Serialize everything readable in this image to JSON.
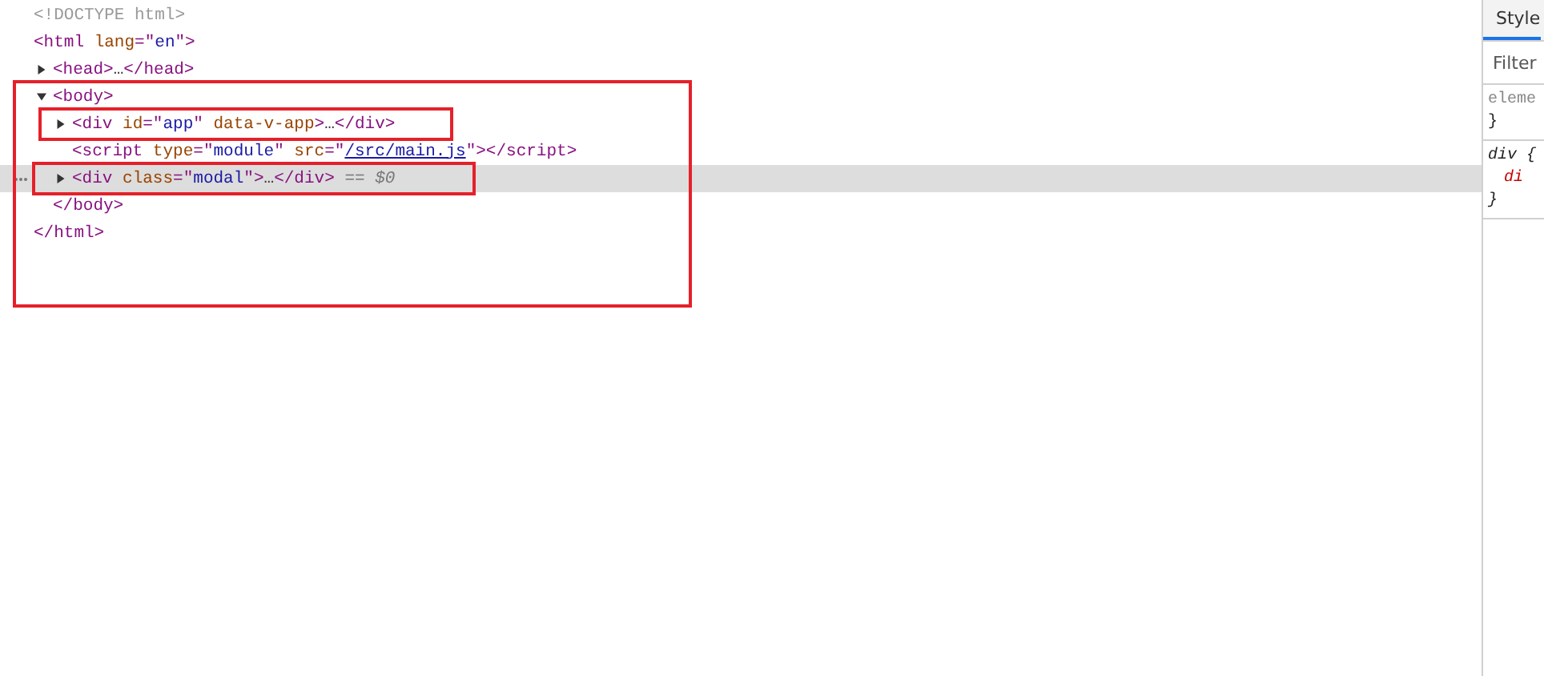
{
  "elements_tree": [
    {
      "tokens": [
        {
          "kind": "doctype",
          "text": "<!DOCTYPE html>"
        }
      ],
      "selected": false
    },
    {
      "tokens": [
        {
          "kind": "tag",
          "text": "<html "
        },
        {
          "kind": "attr",
          "text": "lang"
        },
        {
          "kind": "tag",
          "text": "=\""
        },
        {
          "kind": "value",
          "text": "en"
        },
        {
          "kind": "tag",
          "text": "\">"
        }
      ],
      "selected": false,
      "closing": "</html>",
      "children": [
        {
          "tokens": [
            {
              "kind": "tag",
              "text": "<head>"
            },
            {
              "kind": "plain",
              "text": "…"
            },
            {
              "kind": "tag",
              "text": "</head>"
            }
          ],
          "expanded": false,
          "selected": false
        },
        {
          "tokens": [
            {
              "kind": "tag",
              "text": "<body>"
            }
          ],
          "expanded": true,
          "selected": false,
          "closing": "</body>",
          "children": [
            {
              "tokens": [
                {
                  "kind": "tag",
                  "text": "<div "
                },
                {
                  "kind": "attr",
                  "text": "id"
                },
                {
                  "kind": "tag",
                  "text": "=\""
                },
                {
                  "kind": "value",
                  "text": "app"
                },
                {
                  "kind": "tag",
                  "text": "\" "
                },
                {
                  "kind": "attr",
                  "text": "data-v-app"
                },
                {
                  "kind": "tag",
                  "text": ">"
                },
                {
                  "kind": "plain",
                  "text": "…"
                },
                {
                  "kind": "tag",
                  "text": "</div>"
                }
              ],
              "expanded": false,
              "selected": false
            },
            {
              "tokens": [
                {
                  "kind": "tag",
                  "text": "<script "
                },
                {
                  "kind": "attr",
                  "text": "type"
                },
                {
                  "kind": "tag",
                  "text": "=\""
                },
                {
                  "kind": "value",
                  "text": "module"
                },
                {
                  "kind": "tag",
                  "text": "\" "
                },
                {
                  "kind": "attr",
                  "text": "src"
                },
                {
                  "kind": "tag",
                  "text": "=\""
                },
                {
                  "kind": "link",
                  "text": "/src/main.js"
                },
                {
                  "kind": "tag",
                  "text": "\"></script>"
                }
              ],
              "selected": false
            },
            {
              "tokens": [
                {
                  "kind": "tag",
                  "text": "<div "
                },
                {
                  "kind": "attr",
                  "text": "class"
                },
                {
                  "kind": "tag",
                  "text": "=\""
                },
                {
                  "kind": "value",
                  "text": "modal"
                },
                {
                  "kind": "tag",
                  "text": "\">"
                },
                {
                  "kind": "plain",
                  "text": "…"
                },
                {
                  "kind": "tag",
                  "text": "</div>"
                },
                {
                  "kind": "marker",
                  "text": " == $0"
                }
              ],
              "expanded": false,
              "selected": true
            }
          ]
        }
      ]
    }
  ],
  "styles_pane": {
    "tabs": [
      {
        "label": "Style",
        "selected": true
      }
    ],
    "filter": {
      "placeholder": "Filter"
    },
    "rules": [
      {
        "lines": [
          {
            "kind": "selector",
            "text": "eleme"
          },
          {
            "kind": "brace",
            "text": "}"
          }
        ]
      },
      {
        "lines": [
          {
            "kind": "rule-selector",
            "text": "div {"
          },
          {
            "kind": "property",
            "text": "di"
          },
          {
            "kind": "rule-brace",
            "text": "}"
          }
        ]
      }
    ]
  }
}
